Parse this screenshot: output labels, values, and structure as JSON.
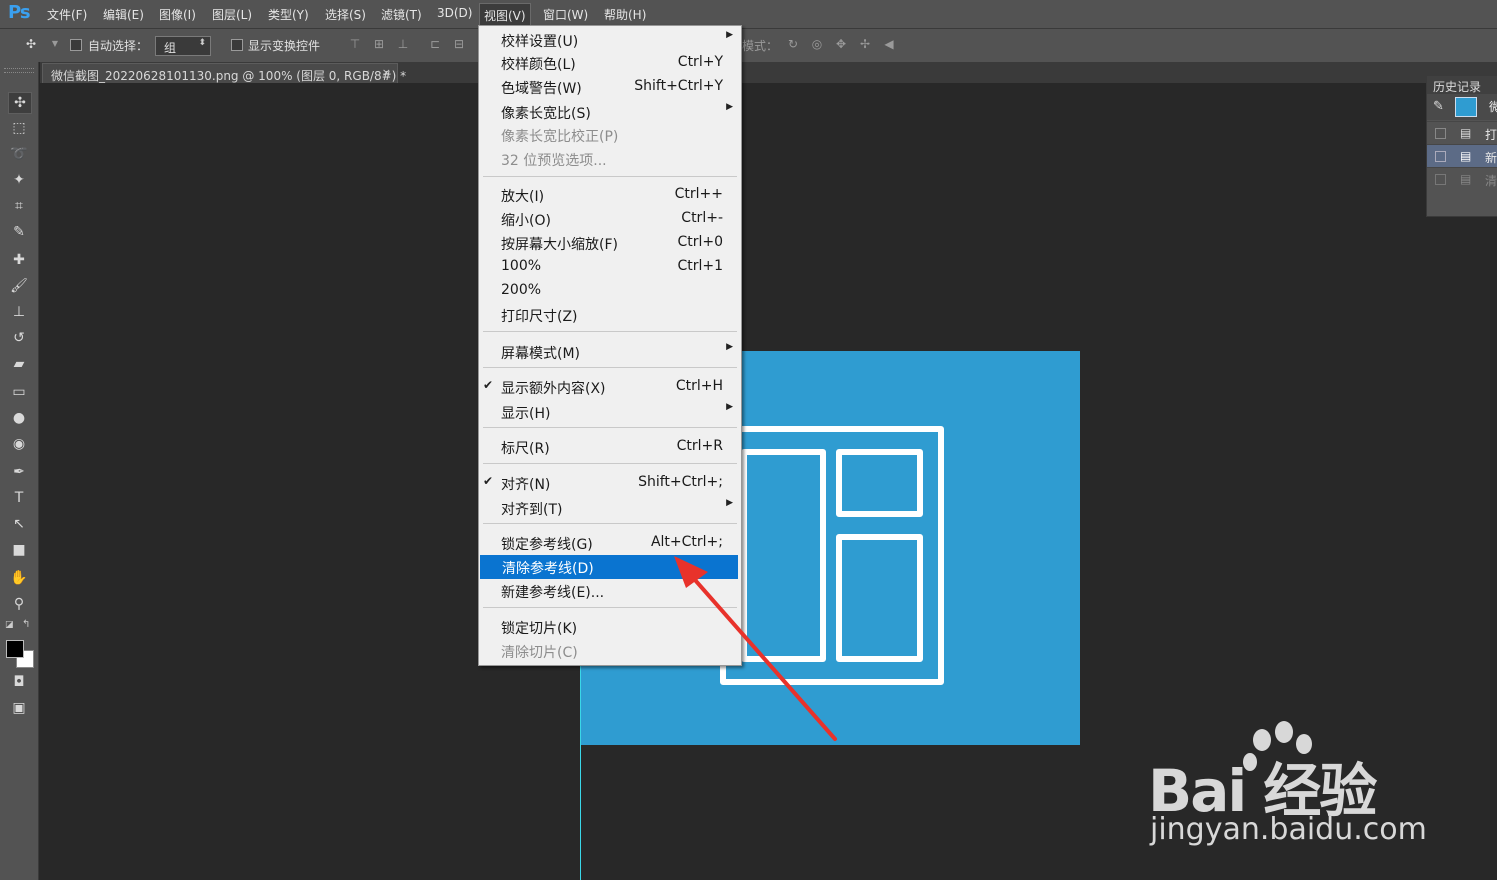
{
  "app": {
    "logo": "Ps"
  },
  "menubar": [
    {
      "label": "文件(F)"
    },
    {
      "label": "编辑(E)"
    },
    {
      "label": "图像(I)"
    },
    {
      "label": "图层(L)"
    },
    {
      "label": "类型(Y)"
    },
    {
      "label": "选择(S)"
    },
    {
      "label": "滤镜(T)"
    },
    {
      "label": "3D(D)"
    },
    {
      "label": "视图(V)"
    },
    {
      "label": "窗口(W)"
    },
    {
      "label": "帮助(H)"
    }
  ],
  "options": {
    "auto_select": "自动选择：",
    "auto_select_value": "组",
    "show_transform": "显示变换控件",
    "mode_3d": "模式："
  },
  "document": {
    "tab_title": "微信截图_20220628101130.png @ 100% (图层 0, RGB/8#) *",
    "close": "×"
  },
  "history": {
    "title": "历史记录",
    "snapshot_label": "微",
    "rows": [
      {
        "label": "打"
      },
      {
        "label": "新"
      },
      {
        "label": "清"
      }
    ]
  },
  "view_menu": {
    "items": [
      {
        "label": "校样设置(U)",
        "shortcut": "",
        "submenu": true
      },
      {
        "label": "校样颜色(L)",
        "shortcut": "Ctrl+Y"
      },
      {
        "label": "色域警告(W)",
        "shortcut": "Shift+Ctrl+Y"
      },
      {
        "label": "像素长宽比(S)",
        "shortcut": "",
        "submenu": true
      },
      {
        "label": "像素长宽比校正(P)",
        "shortcut": "",
        "disabled": true
      },
      {
        "label": "32 位预览选项...",
        "shortcut": "",
        "disabled": true
      },
      {
        "label": "放大(I)",
        "shortcut": "Ctrl++"
      },
      {
        "label": "缩小(O)",
        "shortcut": "Ctrl+-"
      },
      {
        "label": "按屏幕大小缩放(F)",
        "shortcut": "Ctrl+0"
      },
      {
        "label": "100%",
        "shortcut": "Ctrl+1"
      },
      {
        "label": "200%",
        "shortcut": ""
      },
      {
        "label": "打印尺寸(Z)",
        "shortcut": ""
      },
      {
        "label": "屏幕模式(M)",
        "shortcut": "",
        "submenu": true
      },
      {
        "label": "显示额外内容(X)",
        "shortcut": "Ctrl+H",
        "checked": true
      },
      {
        "label": "显示(H)",
        "shortcut": "",
        "submenu": true
      },
      {
        "label": "标尺(R)",
        "shortcut": "Ctrl+R"
      },
      {
        "label": "对齐(N)",
        "shortcut": "Shift+Ctrl+;",
        "checked": true
      },
      {
        "label": "对齐到(T)",
        "shortcut": "",
        "submenu": true
      },
      {
        "label": "锁定参考线(G)",
        "shortcut": "Alt+Ctrl+;"
      },
      {
        "label": "清除参考线(D)",
        "shortcut": "",
        "highlighted": true
      },
      {
        "label": "新建参考线(E)...",
        "shortcut": ""
      },
      {
        "label": "锁定切片(K)",
        "shortcut": ""
      },
      {
        "label": "清除切片(C)",
        "shortcut": "",
        "disabled": true
      }
    ]
  },
  "watermark": {
    "logo": "Bai  经验",
    "url": "jingyan.baidu.com"
  },
  "colors": {
    "accent": "#0a74d0",
    "image_bg": "#2f9cd1",
    "arrow": "#e8322b",
    "guide": "#3ad7e8"
  }
}
